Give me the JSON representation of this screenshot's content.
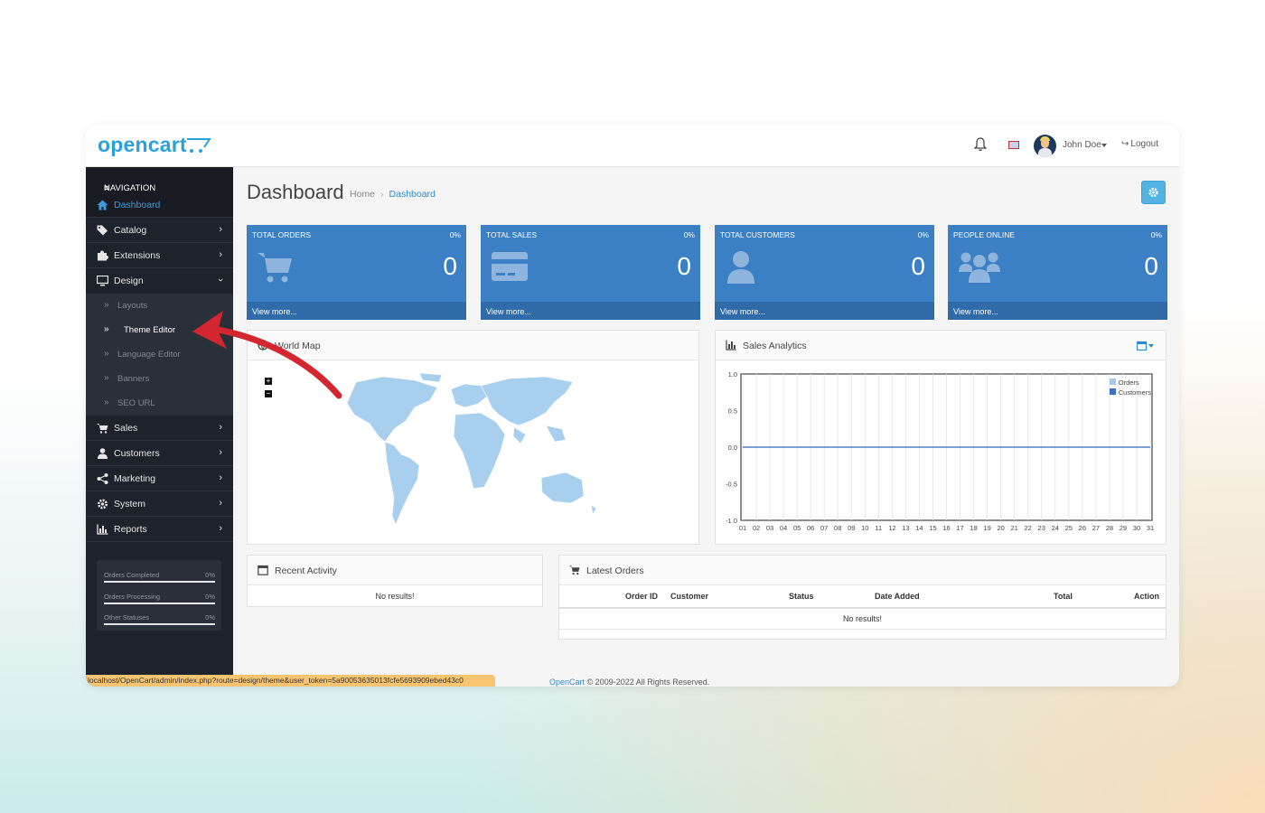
{
  "header": {
    "logo_text": "opencart",
    "user_name": "John Doe",
    "logout_label": "Logout"
  },
  "sidebar": {
    "nav_title": "NAVIGATION",
    "items": [
      {
        "label": "Dashboard",
        "icon": "home-icon"
      },
      {
        "label": "Catalog",
        "icon": "tag-icon"
      },
      {
        "label": "Extensions",
        "icon": "puzzle-icon"
      },
      {
        "label": "Design",
        "icon": "monitor-icon"
      },
      {
        "label": "Sales",
        "icon": "cart-icon"
      },
      {
        "label": "Customers",
        "icon": "user-icon"
      },
      {
        "label": "Marketing",
        "icon": "share-icon"
      },
      {
        "label": "System",
        "icon": "gear-icon"
      },
      {
        "label": "Reports",
        "icon": "bar-chart-icon"
      }
    ],
    "design_sub": [
      "Layouts",
      "Theme Editor",
      "Language Editor",
      "Banners",
      "SEO URL"
    ],
    "stats": [
      {
        "label": "Orders Completed",
        "value": "0%"
      },
      {
        "label": "Orders Processing",
        "value": "0%"
      },
      {
        "label": "Other Statuses",
        "value": "0%"
      }
    ],
    "status_url": "localhost/OpenCart/admin/index.php?route=design/theme&user_token=5a90053635013fcfe5693909ebed43c0"
  },
  "page": {
    "title": "Dashboard",
    "breadcrumb_home": "Home",
    "breadcrumb_current": "Dashboard"
  },
  "tiles": [
    {
      "title": "TOTAL ORDERS",
      "percent": "0%",
      "value": "0",
      "link": "View more...",
      "icon": "cart-icon"
    },
    {
      "title": "TOTAL SALES",
      "percent": "0%",
      "value": "0",
      "link": "View more...",
      "icon": "credit-card-icon"
    },
    {
      "title": "TOTAL CUSTOMERS",
      "percent": "0%",
      "value": "0",
      "link": "View more...",
      "icon": "user-icon"
    },
    {
      "title": "PEOPLE ONLINE",
      "percent": "0%",
      "value": "0",
      "link": "View more...",
      "icon": "users-icon"
    }
  ],
  "world_map": {
    "title": "World Map"
  },
  "sales_analytics": {
    "title": "Sales Analytics",
    "legend": [
      "Orders",
      "Customers"
    ]
  },
  "chart_data": {
    "type": "line",
    "title": "Sales Analytics",
    "x": [
      "01",
      "02",
      "03",
      "04",
      "05",
      "06",
      "07",
      "08",
      "09",
      "10",
      "11",
      "12",
      "13",
      "14",
      "15",
      "16",
      "17",
      "18",
      "19",
      "20",
      "21",
      "22",
      "23",
      "24",
      "25",
      "26",
      "27",
      "28",
      "29",
      "30",
      "31"
    ],
    "series": [
      {
        "name": "Orders",
        "values": [
          0,
          0,
          0,
          0,
          0,
          0,
          0,
          0,
          0,
          0,
          0,
          0,
          0,
          0,
          0,
          0,
          0,
          0,
          0,
          0,
          0,
          0,
          0,
          0,
          0,
          0,
          0,
          0,
          0,
          0,
          0
        ],
        "color": "#a8c9ec"
      },
      {
        "name": "Customers",
        "values": [
          0,
          0,
          0,
          0,
          0,
          0,
          0,
          0,
          0,
          0,
          0,
          0,
          0,
          0,
          0,
          0,
          0,
          0,
          0,
          0,
          0,
          0,
          0,
          0,
          0,
          0,
          0,
          0,
          0,
          0,
          0
        ],
        "color": "#3b6fc4"
      }
    ],
    "yticks": [
      "1.0",
      "0.5",
      "0.0",
      "-0.5",
      "-1.0"
    ],
    "ylim": [
      -1,
      1
    ],
    "grid": true,
    "legend_position": "top-right"
  },
  "recent_activity": {
    "title": "Recent Activity",
    "empty": "No results!"
  },
  "latest_orders": {
    "title": "Latest Orders",
    "columns": [
      "Order ID",
      "Customer",
      "Status",
      "Date Added",
      "Total",
      "Action"
    ],
    "empty": "No results!"
  },
  "footer": {
    "link": "OpenCart",
    "text": "© 2009-2022 All Rights Reserved."
  }
}
